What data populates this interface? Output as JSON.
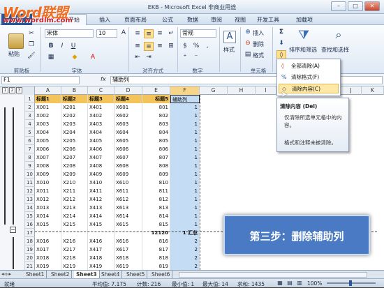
{
  "window": {
    "title": "EKB - Microsoft Excel 非商业用途"
  },
  "watermark": {
    "line1": "Word联盟",
    "line2": "www.wordlm.com"
  },
  "tabs": [
    "文件",
    "开始",
    "插入",
    "页面布局",
    "公式",
    "数据",
    "审阅",
    "视图",
    "开发工具",
    "加载项"
  ],
  "ribbon": {
    "paste": "粘贴",
    "font_name": "宋体",
    "font_size": "10",
    "number_format": "常规",
    "style": "样式",
    "insert": "插入",
    "delete": "删除",
    "format": "格式",
    "sort_filter": "排序和筛选",
    "find_select": "查找和选择",
    "groups": [
      "剪贴板",
      "字体",
      "对齐方式",
      "数字",
      "单元格"
    ]
  },
  "formula_bar": {
    "name_box": "F1",
    "fx": "fx",
    "content": "辅助列"
  },
  "outline_levels": [
    "1",
    "2",
    "3"
  ],
  "columns": [
    "A",
    "B",
    "C",
    "D",
    "E",
    "F",
    "G",
    "H",
    "I",
    "J",
    "K"
  ],
  "rows": [
    {
      "n": "1",
      "c": [
        "标题1",
        "标题2",
        "标题3",
        "标题4",
        "标题5",
        "辅助列"
      ]
    },
    {
      "n": "2",
      "c": [
        "X001",
        "X201",
        "X401",
        "X601",
        "801",
        "1"
      ]
    },
    {
      "n": "3",
      "c": [
        "X002",
        "X202",
        "X402",
        "X602",
        "802",
        "1"
      ]
    },
    {
      "n": "4",
      "c": [
        "X003",
        "X203",
        "X403",
        "X603",
        "803",
        "1"
      ]
    },
    {
      "n": "5",
      "c": [
        "X004",
        "X204",
        "X404",
        "X604",
        "804",
        "1"
      ]
    },
    {
      "n": "6",
      "c": [
        "X005",
        "X205",
        "X405",
        "X605",
        "805",
        "1"
      ]
    },
    {
      "n": "7",
      "c": [
        "X006",
        "X206",
        "X406",
        "X606",
        "806",
        "1"
      ]
    },
    {
      "n": "8",
      "c": [
        "X007",
        "X207",
        "X407",
        "X607",
        "807",
        "1"
      ]
    },
    {
      "n": "9",
      "c": [
        "X008",
        "X208",
        "X408",
        "X608",
        "808",
        "1"
      ]
    },
    {
      "n": "10",
      "c": [
        "X009",
        "X209",
        "X409",
        "X609",
        "809",
        "1"
      ]
    },
    {
      "n": "11",
      "c": [
        "X010",
        "X210",
        "X410",
        "X610",
        "810",
        "1"
      ]
    },
    {
      "n": "12",
      "c": [
        "X011",
        "X211",
        "X411",
        "X611",
        "811",
        "1"
      ]
    },
    {
      "n": "13",
      "c": [
        "X012",
        "X212",
        "X412",
        "X612",
        "812",
        "1"
      ]
    },
    {
      "n": "14",
      "c": [
        "X013",
        "X213",
        "X413",
        "X613",
        "813",
        "1"
      ]
    },
    {
      "n": "15",
      "c": [
        "X014",
        "X214",
        "X414",
        "X614",
        "814",
        "1"
      ]
    },
    {
      "n": "16",
      "c": [
        "X015",
        "X215",
        "X415",
        "X615",
        "815",
        "1"
      ]
    },
    {
      "n": "17",
      "c": [
        "",
        "",
        "",
        "",
        "12120",
        "1 汇总"
      ]
    },
    {
      "n": "18",
      "c": [
        "X016",
        "X216",
        "X416",
        "X616",
        "816",
        "2"
      ]
    },
    {
      "n": "19",
      "c": [
        "X017",
        "X217",
        "X417",
        "X617",
        "817",
        "2"
      ]
    },
    {
      "n": "20",
      "c": [
        "X018",
        "X218",
        "X418",
        "X618",
        "818",
        "2"
      ]
    },
    {
      "n": "21",
      "c": [
        "X019",
        "X219",
        "X419",
        "X619",
        "819",
        "2"
      ]
    }
  ],
  "sheets": [
    "Sheet1",
    "Sheet2",
    "Sheet3",
    "Sheet4",
    "Sheet5",
    "Sheet6"
  ],
  "status": {
    "ready": "就绪",
    "average": "平均值: 7.175",
    "count": "计数: 216",
    "min": "最小值: 1",
    "max": "最大值: 14",
    "sum": "求和: 1435",
    "zoom": "100%"
  },
  "clear_menu": {
    "items": [
      "全部清除(A)",
      "清除格式(F)",
      "清除内容(C)"
    ],
    "highlighted_index": 2
  },
  "tooltip": {
    "title": "清除内容 (Del)",
    "line1": "仅清除所选单元格中的内容。",
    "line2": "格式和注释未被清除。"
  },
  "banner": {
    "text": "第三步：删除辅助列"
  },
  "colors": {
    "header_fill": "#f4c45a",
    "selected_column": "#c5dcf5",
    "banner": "#4a7ac4",
    "file_tab": "#2b5797"
  }
}
